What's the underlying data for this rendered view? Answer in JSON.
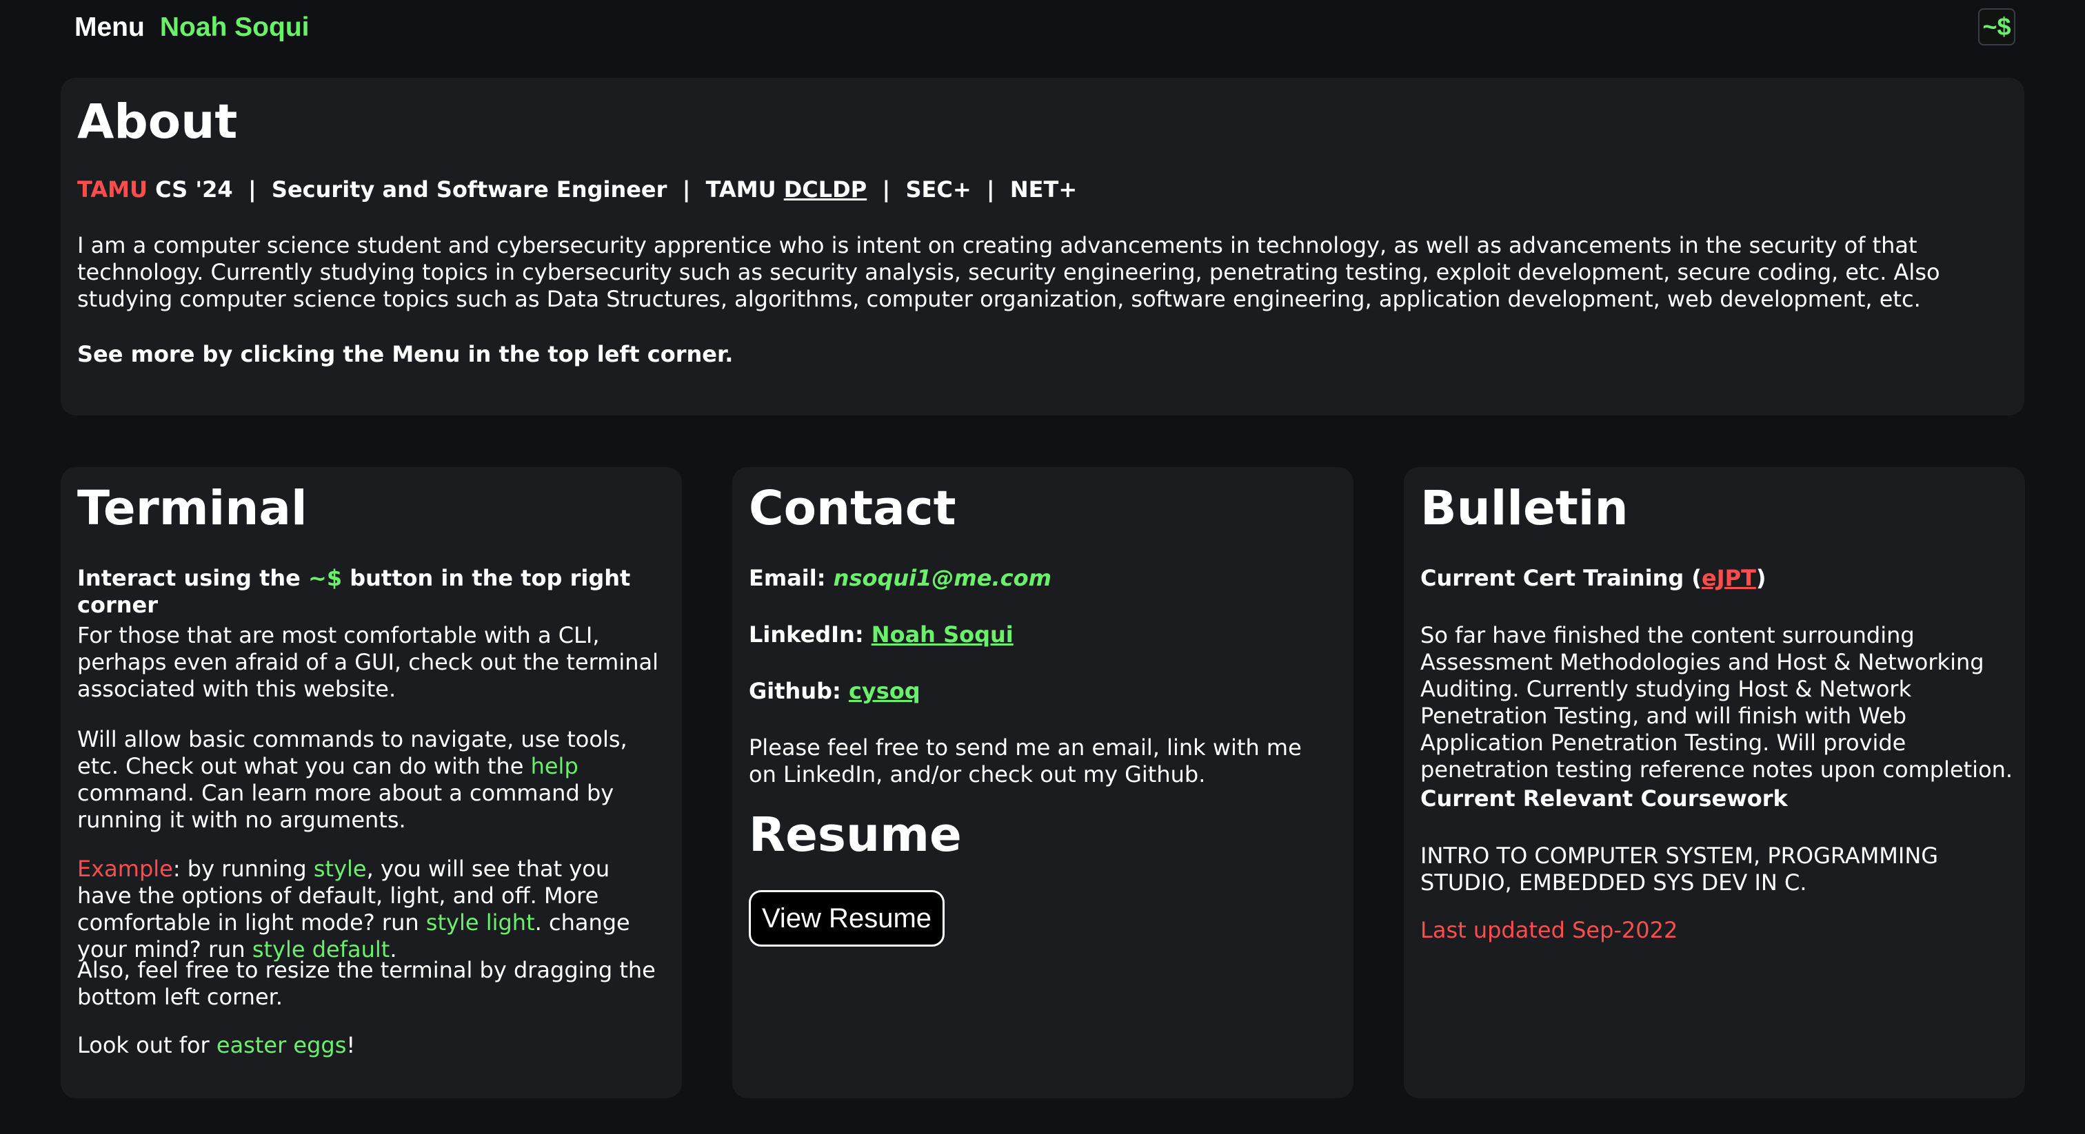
{
  "header": {
    "menu_label": "Menu",
    "site_name": "Noah Soqui",
    "terminal_button": "~$"
  },
  "about": {
    "title": "About",
    "tagline": {
      "tamu": "TAMU",
      "part1": " CS '24  |  Security and Software Engineer  |  TAMU ",
      "dcldp": "DCLDP",
      "part2": "  |  SEC+  |  NET+"
    },
    "description": "I am a computer science student and cybersecurity apprentice who is intent on creating advancements in technology, as well as advancements in the security of that technology. Currently studying topics in cybersecurity such as security analysis, security engineering, penetrating testing, exploit development, secure coding, etc. Also studying computer science topics such as Data Structures, algorithms, computer organization, software engineering, application development, web development, etc.",
    "see_more": "See more by clicking the Menu in the top left corner."
  },
  "terminal": {
    "title": "Terminal",
    "interact": {
      "before": "Interact using the ",
      "button": "~$",
      "after": " button in the top right corner"
    },
    "p1": "For those that are most comfortable with a CLI, perhaps even afraid of a GUI, check out the terminal associated with this website.",
    "p2": {
      "before": "Will allow basic commands to navigate, use tools, etc. Check out what you can do with the ",
      "cmd": "help",
      "after": " command. Can learn more about a command by running it with no arguments."
    },
    "p3": {
      "example": "Example",
      "t1": ": by running ",
      "style": "style",
      "t2": ", you will see that you have the options of default, light, and off. More comfortable in light mode? run ",
      "style_light": "style light",
      "t3": ". change your mind? run ",
      "style_default": "style default",
      "t4": "."
    },
    "p4": "Also, feel free to resize the terminal by dragging the bottom left corner.",
    "p5": {
      "before": "Look out for ",
      "eggs": "easter eggs",
      "after": "!"
    }
  },
  "contact": {
    "title": "Contact",
    "email_label": "Email:",
    "email": "nsoqui1@me.com",
    "linkedin_label": "LinkedIn:",
    "linkedin": "Noah Soqui",
    "github_label": "Github:",
    "github": "cysoq",
    "note": "Please feel free to send me an email, link with me on LinkedIn, and/or check out my Github.",
    "resume_title": "Resume",
    "resume_button": "View Resume"
  },
  "bulletin": {
    "title": "Bulletin",
    "cert": {
      "before": "Current Cert Training (",
      "link": "eJPT",
      "after": ")"
    },
    "cert_text": "So far have finished the content surrounding Assessment Methodologies and Host & Networking Auditing. Currently studying Host & Network Penetration Testing, and will finish with Web Application Penetration Testing. Will provide penetration testing reference notes upon completion.",
    "coursework_title": "Current Relevant Coursework",
    "coursework": "INTRO TO COMPUTER SYSTEM, PROGRAMMING STUDIO, EMBEDDED SYS DEV IN C.",
    "updated": "Last updated Sep-2022"
  }
}
